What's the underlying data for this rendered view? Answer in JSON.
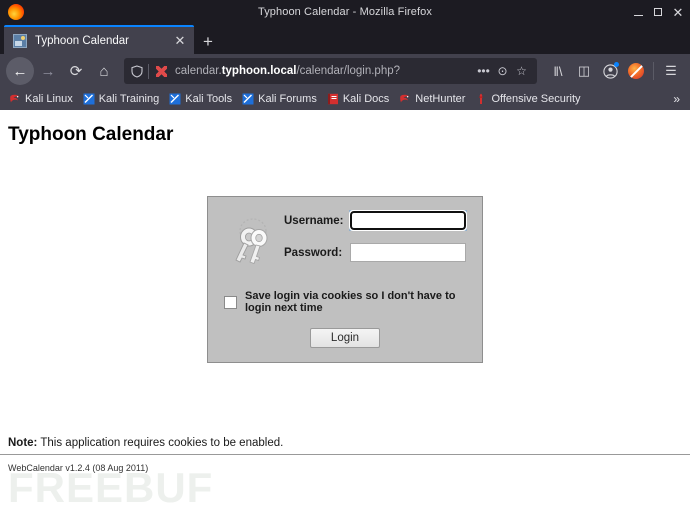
{
  "window": {
    "title": "Typhoon Calendar - Mozilla Firefox",
    "minimize_label": "—",
    "maximize_label": "□",
    "close_label": "✕"
  },
  "tabs": {
    "items": [
      {
        "label": "Typhoon Calendar",
        "favicon": "page-favicon",
        "close_label": "✕"
      }
    ],
    "new_tab_label": "+"
  },
  "toolbar": {
    "back_label": "←",
    "forward_label": "→",
    "reload_label": "⟳",
    "home_label": "⌂",
    "url": {
      "prefix": "calendar.",
      "host": "typhoon.local",
      "path": "/calendar/login.php?",
      "full": "calendar.typhoon.local/calendar/login.php?",
      "shield_icon": "shield-icon",
      "insecure_icon": "no-https-icon"
    },
    "page_actions_label": "•••",
    "reader_label": "⊙",
    "bookmark_star_label": "☆",
    "library_label": "‖\\",
    "sidebar_label": "◫",
    "account_label": "●",
    "extension_label": "blocked-extension-icon",
    "menu_label": "☰"
  },
  "bookmarks": {
    "items": [
      {
        "label": "Kali Linux",
        "icon": "kali-dragon-icon",
        "color": "#d32f2f"
      },
      {
        "label": "Kali Training",
        "icon": "kali-blue-icon",
        "color": "#1e6fd9"
      },
      {
        "label": "Kali Tools",
        "icon": "kali-blue-icon",
        "color": "#1e6fd9"
      },
      {
        "label": "Kali Forums",
        "icon": "kali-blue-icon",
        "color": "#1e6fd9"
      },
      {
        "label": "Kali Docs",
        "icon": "kali-docs-icon",
        "color": "#d32f2f"
      },
      {
        "label": "NetHunter",
        "icon": "nethunter-icon",
        "color": "#d32f2f"
      },
      {
        "label": "Offensive Security",
        "icon": "offsec-torch-icon",
        "color": "#d32f2f"
      }
    ],
    "overflow_label": "»"
  },
  "page": {
    "heading": "Typhoon Calendar",
    "login": {
      "keys_icon": "keyring-icon",
      "username_label": "Username:",
      "username_value": "",
      "username_placeholder": "",
      "password_label": "Password:",
      "password_value": "",
      "password_placeholder": "",
      "cookie_checkbox_label": "Save login via cookies so I don't have to login next time",
      "cookie_checked": false,
      "submit_label": "Login"
    },
    "note_prefix": "Note:",
    "note_text": " This application requires cookies to be enabled.",
    "version": "WebCalendar v1.2.4 (08 Aug 2011)",
    "watermark": "FREEBUF"
  },
  "colors": {
    "chrome_bg": "#1c1b22",
    "toolbar_bg": "#42414d",
    "urlbar_bg": "#2b2a33",
    "tab_accent": "#0a84ff",
    "form_bg": "#c0c0c0",
    "focus_ring": "#3a8fe0",
    "page_bg": "#ffffff"
  }
}
